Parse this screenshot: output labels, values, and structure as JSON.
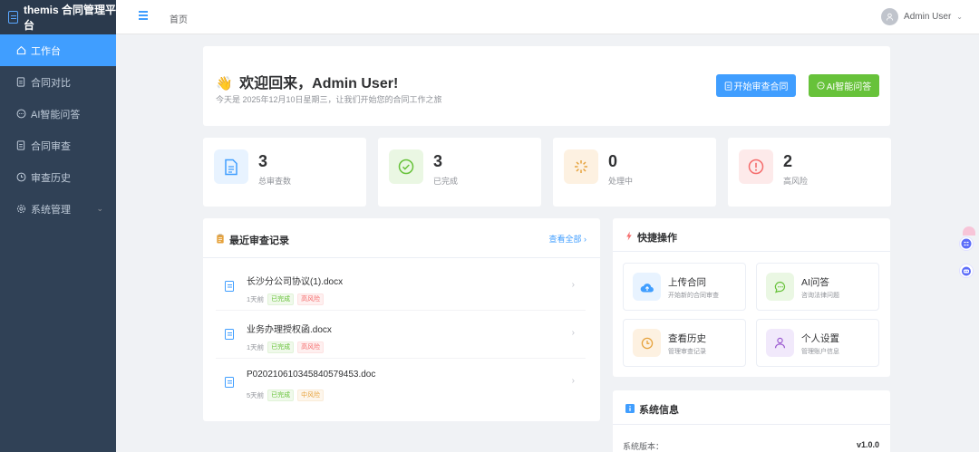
{
  "app": {
    "brand": "themis 合同管理平台"
  },
  "sidebar": {
    "items": [
      {
        "label": "工作台",
        "icon": "home-icon"
      },
      {
        "label": "合同对比",
        "icon": "document-icon"
      },
      {
        "label": "AI智能问答",
        "icon": "chat-icon"
      },
      {
        "label": "合同审查",
        "icon": "document-icon"
      },
      {
        "label": "审查历史",
        "icon": "clock-icon"
      },
      {
        "label": "系统管理",
        "icon": "gear-icon"
      }
    ]
  },
  "header": {
    "breadcrumb": "首页",
    "user_name": "Admin User"
  },
  "welcome": {
    "wave": "👋",
    "title": "欢迎回来，Admin User!",
    "subtitle": "今天是 2025年12月10日星期三，让我们开始您的合同工作之旅",
    "btn_review": "开始审查合同",
    "btn_ai": "AI智能问答"
  },
  "stats": [
    {
      "value": "3",
      "label": "总审查数",
      "color": "#409eff"
    },
    {
      "value": "3",
      "label": "已完成",
      "color": "#67c23a"
    },
    {
      "value": "0",
      "label": "处理中",
      "color": "#e6a23c"
    },
    {
      "value": "2",
      "label": "高风险",
      "color": "#f56c6c"
    }
  ],
  "recent": {
    "title": "最近审查记录",
    "view_all": "查看全部 ›",
    "items": [
      {
        "name": "长沙分公司协议(1).docx",
        "time": "1天前",
        "status": "已完成",
        "risk": "高风险"
      },
      {
        "name": "业务办理授权函.docx",
        "time": "1天前",
        "status": "已完成",
        "risk": "高风险"
      },
      {
        "name": "P020210610345840579453.doc",
        "time": "5天前",
        "status": "已完成",
        "risk": "中风险"
      }
    ]
  },
  "quick": {
    "title": "快捷操作",
    "items": [
      {
        "title": "上传合同",
        "sub": "开始新的合同审查",
        "icon": "cloud-upload-icon"
      },
      {
        "title": "AI问答",
        "sub": "咨询法律问题",
        "icon": "chat-icon"
      },
      {
        "title": "查看历史",
        "sub": "管理审查记录",
        "icon": "clock-icon"
      },
      {
        "title": "个人设置",
        "sub": "管理账户信息",
        "icon": "user-icon"
      }
    ]
  },
  "sysinfo": {
    "title": "系统信息",
    "version_label": "系统版本：",
    "version_value": "v1.0.0"
  },
  "colors": {
    "primary": "#409eff",
    "success": "#67c23a",
    "warning": "#e6a23c",
    "danger": "#f56c6c",
    "sidebar": "#304156"
  }
}
